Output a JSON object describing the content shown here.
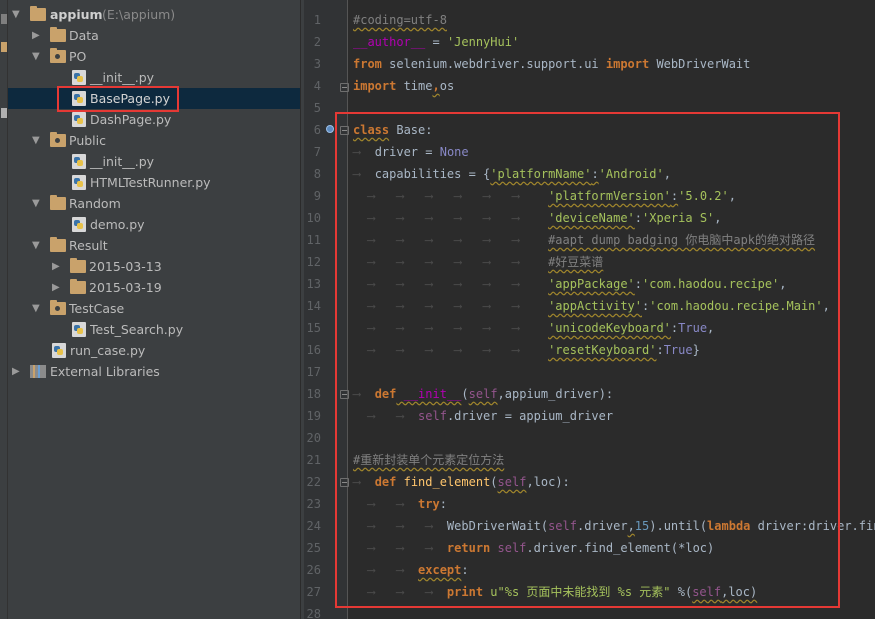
{
  "project_tree": {
    "root": {
      "name": "appium",
      "path": "(E:\\appium)"
    },
    "items": [
      {
        "label": "Data",
        "type": "folder"
      },
      {
        "label": "PO",
        "type": "package"
      },
      {
        "label": "__init__.py",
        "type": "python"
      },
      {
        "label": "BasePage.py",
        "type": "python"
      },
      {
        "label": "DashPage.py",
        "type": "python"
      },
      {
        "label": "Public",
        "type": "package"
      },
      {
        "label": "__init__.py",
        "type": "python"
      },
      {
        "label": "HTMLTestRunner.py",
        "type": "python"
      },
      {
        "label": "Random",
        "type": "folder"
      },
      {
        "label": "demo.py",
        "type": "python"
      },
      {
        "label": "Result",
        "type": "folder"
      },
      {
        "label": "2015-03-13",
        "type": "folder"
      },
      {
        "label": "2015-03-19",
        "type": "folder"
      },
      {
        "label": "TestCase",
        "type": "package"
      },
      {
        "label": "Test_Search.py",
        "type": "python"
      },
      {
        "label": "run_case.py",
        "type": "python"
      },
      {
        "label": "External Libraries",
        "type": "library"
      }
    ],
    "selected": "BasePage.py"
  },
  "editor": {
    "line_numbers": [
      "1",
      "2",
      "3",
      "4",
      "5",
      "6",
      "7",
      "8",
      "9",
      "10",
      "11",
      "12",
      "13",
      "14",
      "15",
      "16",
      "17",
      "18",
      "19",
      "20",
      "21",
      "22",
      "23",
      "24",
      "25",
      "26",
      "27",
      "28"
    ],
    "code": {
      "l1": "#coding=utf-8",
      "l2a": "__author__",
      "l2b": " = ",
      "l2c": "'JennyHui'",
      "l3a": "from",
      "l3b": " selenium.webdriver.support.ui ",
      "l3c": "import",
      "l3d": " WebDriverWait",
      "l4a": "import",
      "l4b": " time",
      "l4c": ",",
      "l4d": "os",
      "l6a": "class",
      "l6b": " Base",
      "l6c": ":",
      "l7a": "driver = ",
      "l7b": "None",
      "l8a": "capabilities = {",
      "l8b": "'platformName'",
      "l8c": ":",
      "l8d": "'Android'",
      "l8e": ",",
      "l9a": "'platformVersion'",
      "l9b": ":",
      "l9c": "'5.0.2'",
      "l9d": ",",
      "l10a": "'deviceName'",
      "l10b": ":",
      "l10c": "'Xperia S'",
      "l10d": ",",
      "l11": "#aapt dump badging 你电脑中apk的绝对路径",
      "l12": "#好豆菜谱",
      "l13a": "'appPackage'",
      "l13b": ":",
      "l13c": "'com.haodou.recipe'",
      "l13d": ",",
      "l14a": "'appActivity'",
      "l14b": ":",
      "l14c": "'com.haodou.recipe.Main'",
      "l14d": ",",
      "l15a": "'unicodeKeyboard'",
      "l15b": ":",
      "l15c": "True",
      "l15d": ",",
      "l16a": "'resetKeyboard'",
      "l16b": ":",
      "l16c": "True",
      "l16d": "}",
      "l18a": "def",
      "l18b": " __init__",
      "l18c": "(",
      "l18d": "self",
      "l18e": ",appium_driver):",
      "l19a": "self",
      "l19b": ".driver = appium_driver",
      "l21": "#重新封装单个元素定位方法",
      "l22a": "def",
      "l22b": " find_element",
      "l22c": "(",
      "l22d": "self",
      "l22e": ",loc):",
      "l23a": "try",
      "l23b": ":",
      "l24a": "WebDriverWait(",
      "l24b": "self",
      "l24c": ".driver",
      "l24d": ",",
      "l24e": "15",
      "l24f": ").until(",
      "l24g": "lambda",
      "l24h": " driver:driver.find_",
      "l25a": "return",
      "l25b": " self",
      "l25c": ".driver.find_element(*loc)",
      "l26a": "except",
      "l26b": ":",
      "l27a": "print",
      "l27b": " u\"%s 页面中未能找到 %s 元素\" ",
      "l27c": "%(",
      "l27d": "self",
      "l27e": ",loc)"
    },
    "indent_marker": "⟶"
  },
  "colors": {
    "annotation_border": "#e53935",
    "keyword": "#cc7832",
    "string": "#a5c25c",
    "comment": "#808080",
    "self": "#94558d"
  }
}
